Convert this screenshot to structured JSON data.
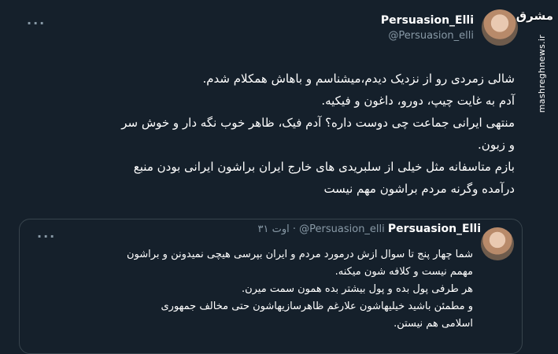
{
  "watermark": {
    "logo": "مشرق",
    "url": "mashreghnews.ir"
  },
  "tweet": {
    "display_name": "Persuasion_Elli",
    "handle": "@Persuasion_elli",
    "more": "···",
    "lines": [
      "شالی زمردی رو از نزدیک دیدم،میشناسم و باهاش همکلام شدم.",
      "آدم به غایت چیپ، دورو، داغون و فیکیه.",
      "منتهی ایرانی جماعت چی دوست داره؟ آدم فیک، ظاهر خوب نگه دار و خوش سر",
      "و زبون.",
      "بازم متاسفانه مثل خیلی از سلبریدی های خارج ایران براشون ایرانی بودن منبع",
      "درآمده وگرنه مردم براشون مهم نیست"
    ]
  },
  "quoted_tweet": {
    "display_name": "Persuasion_Elli",
    "handle": "@Persuasion_elli",
    "separator": "·",
    "date": "۳۱ اوت",
    "more": "···",
    "lines": [
      "شما چهار پنج تا سوال ازش درمورد مردم و ایران بپرسی هیچی نمیدونن و براشون",
      "مهمم نیست و کلافه شون میکنه.",
      "هر طرفی پول بده و پول بیشتر بده همون سمت میرن.",
      "و مطمئن باشید خیلیهاشون علارغم ظاهرسازیهاشون حتی مخالف جمهوری",
      "اسلامی هم نیستن."
    ]
  }
}
